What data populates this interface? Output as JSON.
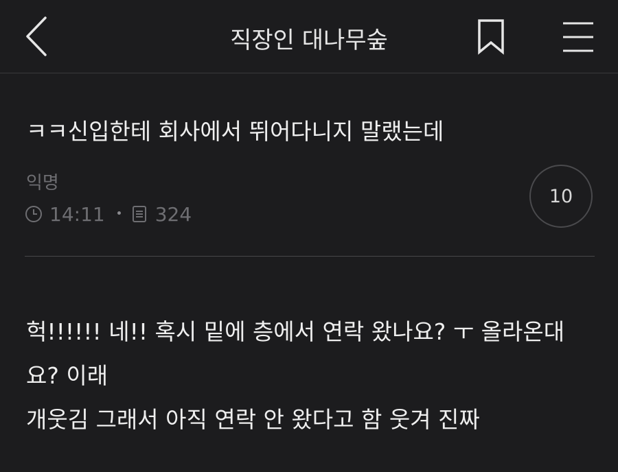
{
  "header": {
    "title": "직장인 대나무숲"
  },
  "post": {
    "title": "ㅋㅋ신입한테 회사에서 뛰어다니지 말랬는데",
    "author": "익명",
    "time": "14:11",
    "views": "324",
    "comment_count": "10",
    "body_lines": [
      "헉!!!!!! 네!! 혹시 밑에 층에서 연락 왔나요? ㅜ 올라온대",
      "요? 이래",
      "개웃김 그래서 아직 연락 안 왔다고 함 웃겨 진짜"
    ]
  },
  "icons": {
    "back": "chevron-left-icon",
    "bookmark": "bookmark-icon",
    "menu": "hamburger-menu-icon",
    "clock": "clock-icon",
    "views": "document-icon"
  },
  "colors": {
    "background": "#1c1c1e",
    "text_primary": "#efefef",
    "text_secondary": "#6e6e72",
    "divider": "#48484a"
  }
}
